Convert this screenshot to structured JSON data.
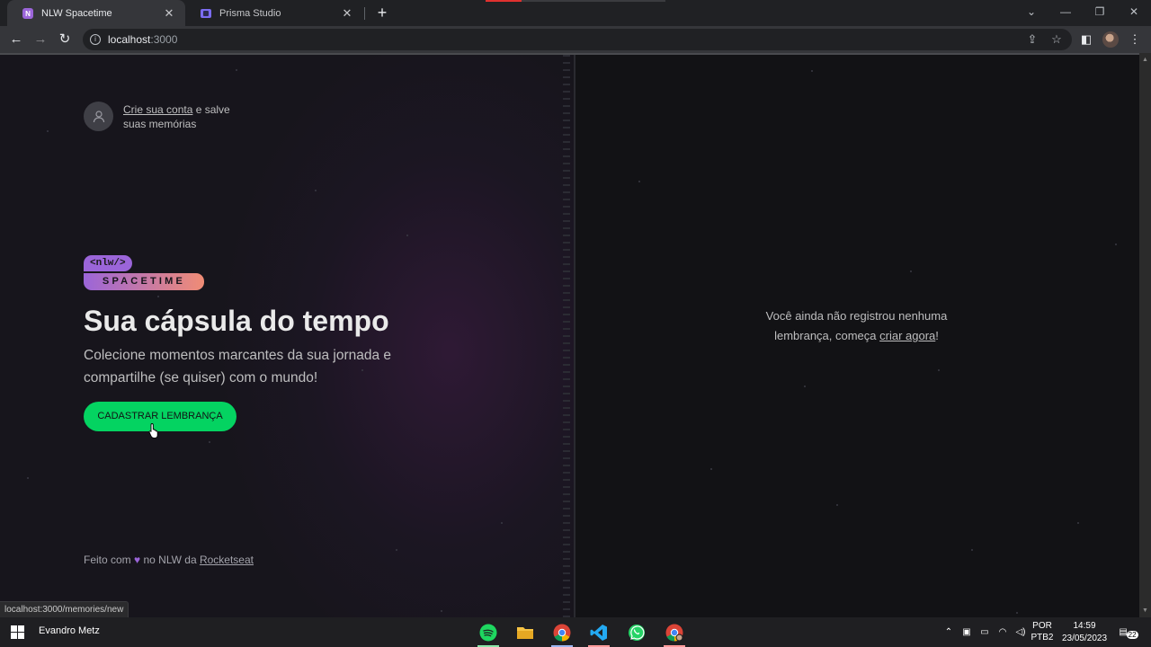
{
  "browser": {
    "tabs": [
      {
        "title": "NLW Spacetime",
        "active": true
      },
      {
        "title": "Prisma Studio",
        "active": false
      }
    ],
    "close_glyph": "✕",
    "new_tab_glyph": "+",
    "url_host": "localhost",
    "url_port": ":3000",
    "status_url": "localhost:3000/memories/new"
  },
  "page": {
    "signin": {
      "link_text": "Crie sua conta",
      "rest_text": " e salve suas memórias"
    },
    "logo": {
      "tag": "<nlw/>",
      "name": "SPACETIME"
    },
    "headline": "Sua cápsula do tempo",
    "subhead": "Colecione momentos marcantes da sua jornada e compartilhe (se quiser) com o mundo!",
    "cta_label": "CADASTRAR LEMBRANÇA",
    "footer": {
      "prefix": "Feito com ",
      "heart": "♥",
      "middle": " no NLW da ",
      "link": "Rocketseat"
    },
    "empty_state": {
      "text": "Você ainda não registrou nenhuma lembrança, começa ",
      "link": "criar agora",
      "suffix": "!"
    }
  },
  "taskbar": {
    "user": "Evandro Metz",
    "lang_top": "POR",
    "lang_bottom": "PTB2",
    "time": "14:59",
    "date": "23/05/2023",
    "notification_count": "22"
  },
  "colors": {
    "accent_green": "#04d361",
    "purple": "#9b65d9",
    "orange": "#f08c75"
  },
  "icons": [
    "tab-favicon-icon",
    "back-icon",
    "forward-icon",
    "reload-icon",
    "info-icon",
    "share-icon",
    "star-icon",
    "sidebar-icon",
    "menu-icon",
    "user-icon",
    "heart-icon",
    "windows-start-icon",
    "spotify-icon",
    "folder-icon",
    "chrome-icon",
    "vscode-icon",
    "whatsapp-icon"
  ]
}
